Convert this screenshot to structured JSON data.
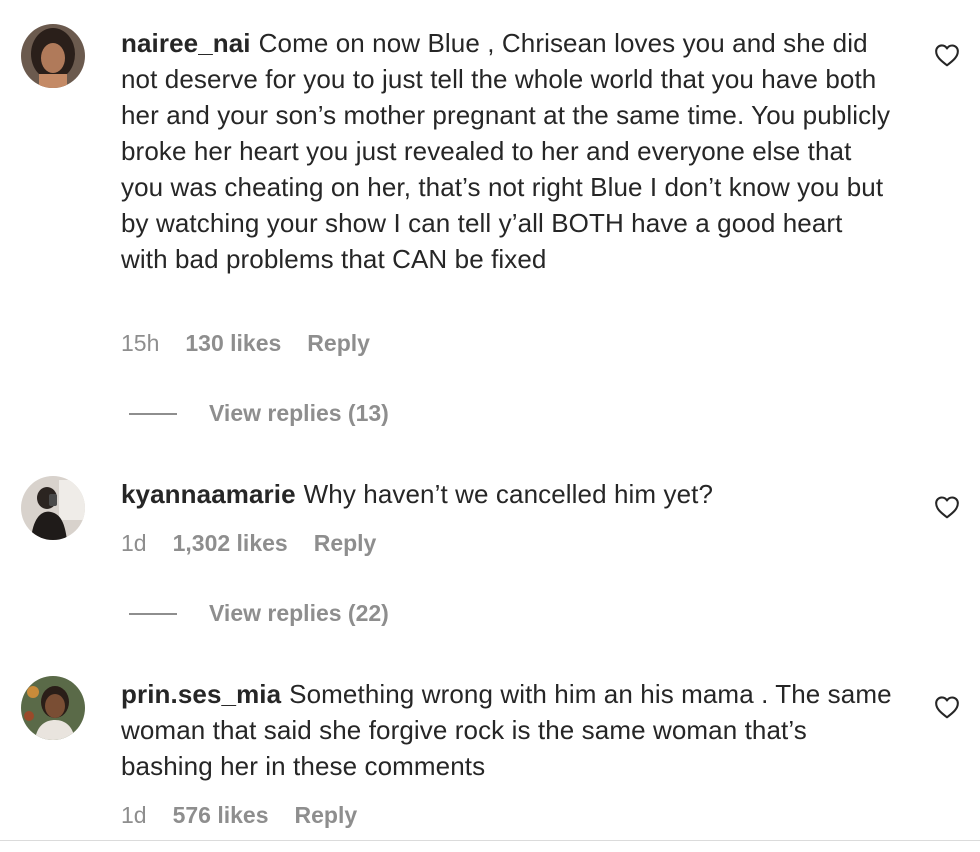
{
  "comments": [
    {
      "username": "nairee_nai",
      "text": "Come on now Blue , Chrisean loves you and she did not deserve for you to just tell the whole world that you have both her and your son’s mother pregnant at the same time. You publicly broke her heart you just revealed to her and everyone else that you was cheating on her, that’s not right Blue I don’t know you but by watching your show I can tell y’all BOTH have a good heart with bad problems that CAN be fixed",
      "time": "15h",
      "likes": "130 likes",
      "reply_label": "Reply",
      "view_replies": "View replies (13)",
      "like_icon": "heart-outline-icon"
    },
    {
      "username": "kyannaamarie",
      "text": "Why haven’t we cancelled him yet?",
      "time": "1d",
      "likes": "1,302 likes",
      "reply_label": "Reply",
      "view_replies": "View replies (22)",
      "like_icon": "heart-outline-icon"
    },
    {
      "username": "prin.ses_mia",
      "text": "Something wrong with him an his mama . The same woman that said she forgive rock is the same woman that’s bashing her in these comments",
      "time": "1d",
      "likes": "576 likes",
      "reply_label": "Reply",
      "like_icon": "heart-outline-icon"
    }
  ],
  "colors": {
    "primary_text": "#262626",
    "secondary_text": "#8e8e8e",
    "background": "#ffffff"
  }
}
